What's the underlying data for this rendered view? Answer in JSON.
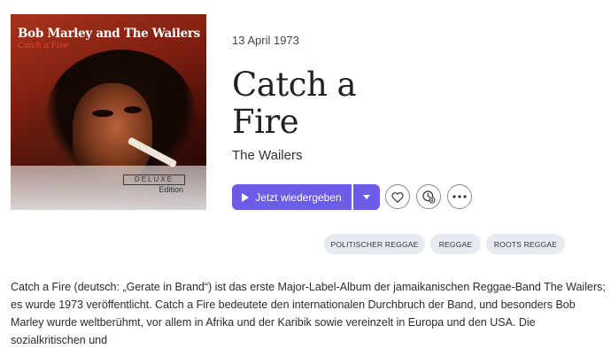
{
  "album": {
    "cover": {
      "artist_text": "Bob Marley and The Wailers",
      "title_text": "Catch a Fire",
      "badge_text": "DELUXE",
      "edition_text": "Edition"
    },
    "release_date": "13 April 1973",
    "title": "Catch a Fire",
    "artist": "The Wailers"
  },
  "actions": {
    "play_label": "Jetzt wiedergeben",
    "accent_color": "#6c5ce7",
    "icons": [
      "play-icon",
      "chevron-down-icon",
      "heart-icon",
      "clock-plus-icon",
      "more-icon"
    ]
  },
  "tags": [
    "POLITISCHER REGGAE",
    "REGGAE",
    "ROOTS REGGAE"
  ],
  "description": "Catch a Fire (deutsch: „Gerate in Brand“) ist das erste Major-Label-Album der jamaikanischen Reggae-Band The Wailers; es wurde 1973 veröffentlicht. Catch a Fire bedeutete den internationalen Durchbruch der Band, und besonders Bob Marley wurde weltberühmt, vor allem in Afrika und der Karibik sowie vereinzelt in Europa und den USA. Die sozialkritischen und"
}
